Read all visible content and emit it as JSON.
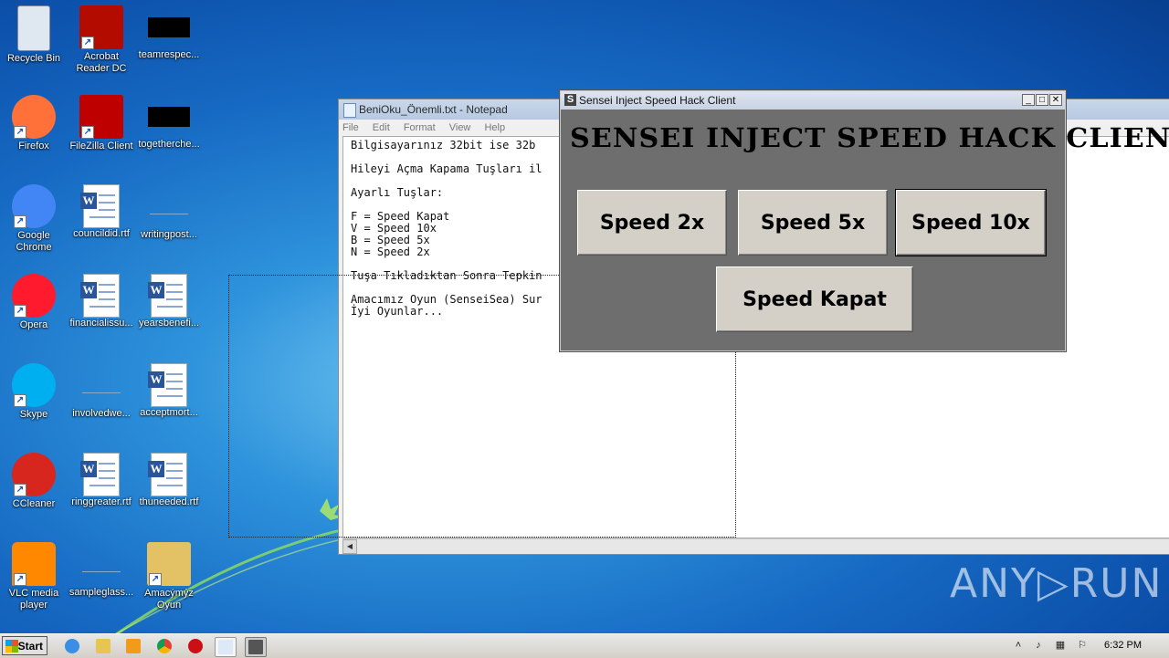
{
  "desktop": {
    "icons": [
      {
        "label": "Recycle Bin",
        "icon": "recycle-bin-icon"
      },
      {
        "label": "Acrobat Reader DC",
        "icon": "acrobat-icon"
      },
      {
        "label": "teamrespec...",
        "icon": "file-icon"
      },
      {
        "label": "Firefox",
        "icon": "firefox-icon"
      },
      {
        "label": "FileZilla Client",
        "icon": "filezilla-icon"
      },
      {
        "label": "togetherche...",
        "icon": "file-icon"
      },
      {
        "label": "Google Chrome",
        "icon": "chrome-icon"
      },
      {
        "label": "councildid.rtf",
        "icon": "word-doc-icon"
      },
      {
        "label": "writingpost...",
        "icon": "file-icon"
      },
      {
        "label": "Opera",
        "icon": "opera-icon"
      },
      {
        "label": "financialissu...",
        "icon": "word-doc-icon"
      },
      {
        "label": "yearsbenefi...",
        "icon": "word-doc-icon"
      },
      {
        "label": "Skype",
        "icon": "skype-icon"
      },
      {
        "label": "involvedwe...",
        "icon": "file-icon"
      },
      {
        "label": "acceptmort...",
        "icon": "word-doc-icon"
      },
      {
        "label": "CCleaner",
        "icon": "ccleaner-icon"
      },
      {
        "label": "ringgreater.rtf",
        "icon": "word-doc-icon"
      },
      {
        "label": "thuneeded.rtf",
        "icon": "word-doc-icon"
      },
      {
        "label": "VLC media player",
        "icon": "vlc-icon"
      },
      {
        "label": "sampleglass...",
        "icon": "file-icon"
      },
      {
        "label": "Amacýmýz Oyun",
        "icon": "folder-icon"
      }
    ]
  },
  "notepad": {
    "title": "BeniOku_Önemli.txt - Notepad",
    "menu": [
      "File",
      "Edit",
      "Format",
      "View",
      "Help"
    ],
    "content": "Bilgisayarınız 32bit ise 32b\n\nHileyi Açma Kapama Tuşları il\n\nAyarlı Tuşlar:\n\nF = Speed Kapat\nV = Speed 10x\nB = Speed 5x\nN = Speed 2x\n\nTuşa Tıkladıktan Sonra Tepkin\n\nAmacımız Oyun (SenseiSea) Sur\nİyi Oyunlar..."
  },
  "hack_client": {
    "title": "Sensei Inject Speed Hack Client",
    "heading": "SENSEI INJECT SPEED HACK CLIENT",
    "buttons": {
      "speed2": "Speed 2x",
      "speed5": "Speed 5x",
      "speed10": "Speed 10x",
      "kapat": "Speed Kapat"
    }
  },
  "taskbar": {
    "start": "Start",
    "clock": "6:32 PM"
  },
  "watermark": "ANY▷RUN"
}
